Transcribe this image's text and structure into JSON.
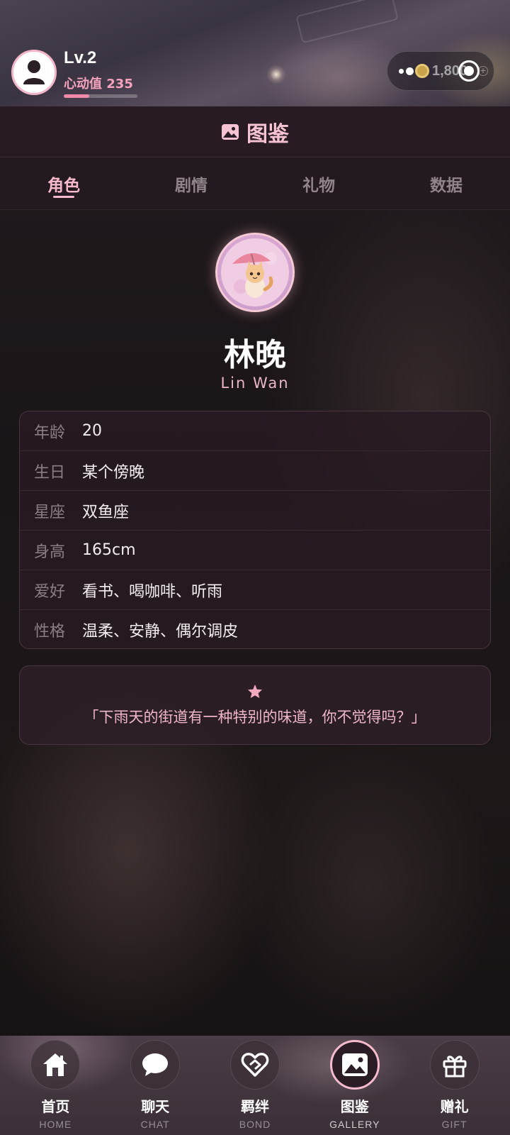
{
  "status": {
    "level": "Lv.2",
    "heart_label": "心动值 235",
    "heart_progress": 0.35,
    "coins": "1,800"
  },
  "header": {
    "title": "图鉴",
    "icon": "gallery-icon"
  },
  "tabs": [
    {
      "label": "角色",
      "active": true
    },
    {
      "label": "剧情",
      "active": false
    },
    {
      "label": "礼物",
      "active": false
    },
    {
      "label": "数据",
      "active": false
    }
  ],
  "character": {
    "name": "林晚",
    "name_en": "Lin Wan",
    "avatar_icon": "cat-umbrella-avatar",
    "info": [
      {
        "key": "年龄",
        "value": "20"
      },
      {
        "key": "生日",
        "value": "某个傍晚"
      },
      {
        "key": "星座",
        "value": "双鱼座"
      },
      {
        "key": "身高",
        "value": "165cm"
      },
      {
        "key": "爱好",
        "value": "看书、喝咖啡、听雨"
      },
      {
        "key": "性格",
        "value": "温柔、安静、偶尔调皮"
      }
    ],
    "quote": "「下雨天的街道有一种特别的味道，你不觉得吗？」"
  },
  "nav": [
    {
      "zh": "首页",
      "en": "HOME",
      "icon": "home-icon",
      "active": false
    },
    {
      "zh": "聊天",
      "en": "CHAT",
      "icon": "chat-bubble-icon",
      "active": false
    },
    {
      "zh": "羁绊",
      "en": "BOND",
      "icon": "heart-link-icon",
      "active": false
    },
    {
      "zh": "图鉴",
      "en": "GALLERY",
      "icon": "gallery-icon",
      "active": true
    },
    {
      "zh": "赠礼",
      "en": "GIFT",
      "icon": "gift-icon",
      "active": false
    }
  ],
  "colors": {
    "accent": "#f7b9cb",
    "panel": "#281b23"
  }
}
